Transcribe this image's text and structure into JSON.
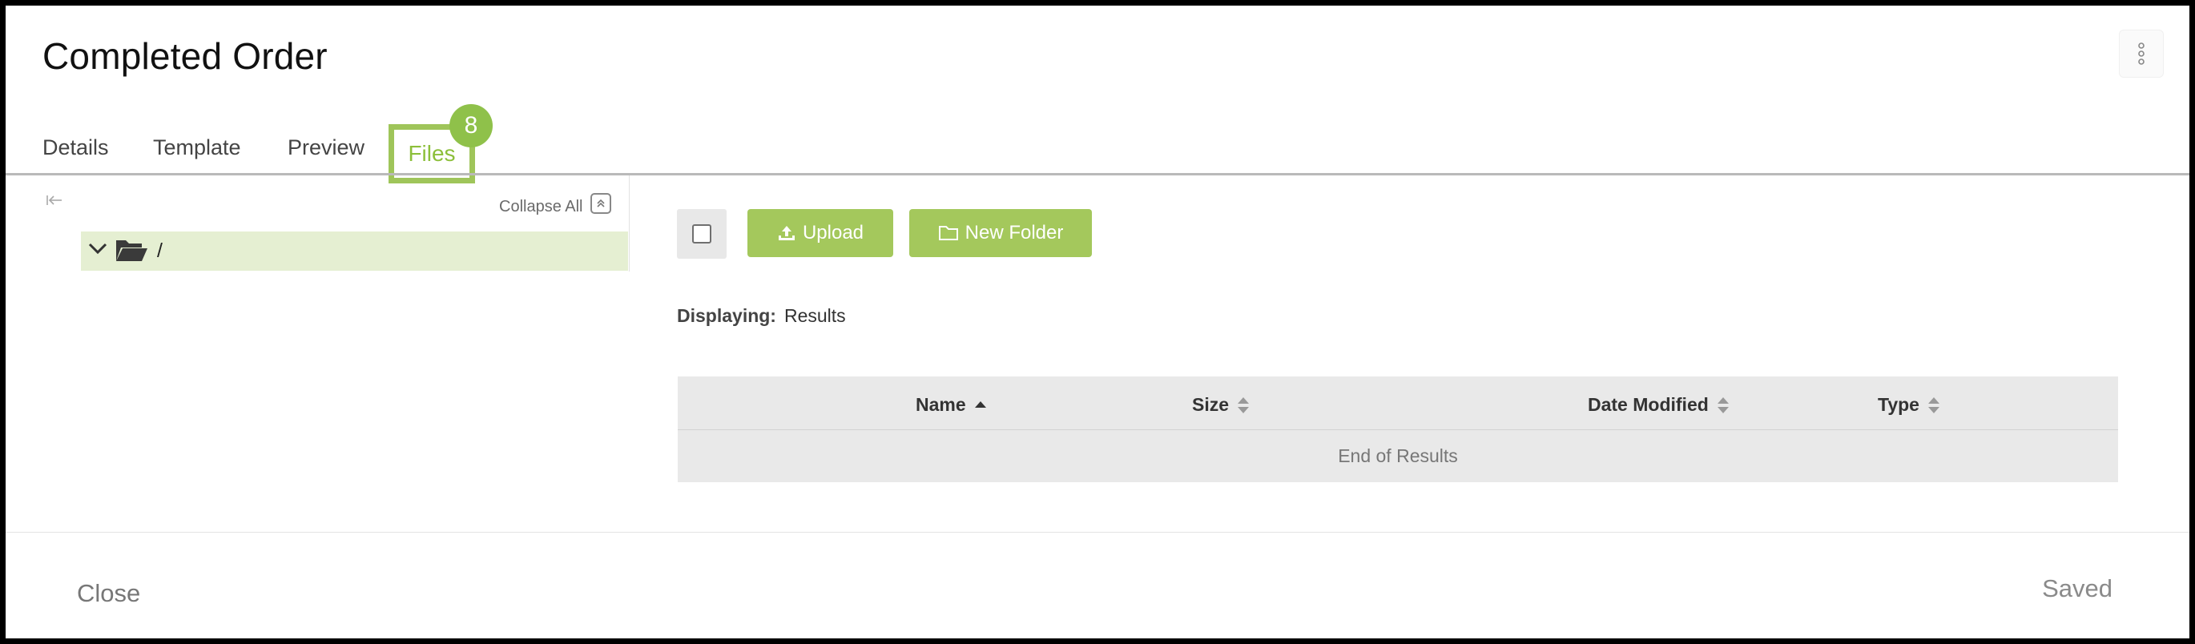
{
  "dialog": {
    "title": "Completed Order",
    "menu_icon": "kebab-vertical-icon"
  },
  "tabs": [
    {
      "label": "Details",
      "active": false
    },
    {
      "label": "Template",
      "active": false
    },
    {
      "label": "Preview",
      "active": false
    },
    {
      "label": "Files",
      "active": true,
      "badge": "8"
    }
  ],
  "sidebar": {
    "collapse_icon": "collapse-left-icon",
    "collapse_all_label": "Collapse All",
    "tree": [
      {
        "label": "/",
        "expanded": true,
        "selected": true,
        "icon": "folder-open-icon"
      }
    ]
  },
  "toolbar": {
    "upload_label": "Upload",
    "new_folder_label": "New Folder"
  },
  "displaying": {
    "label": "Displaying:",
    "value": "Results"
  },
  "table": {
    "columns": [
      {
        "label": "Name",
        "sort": "ascending"
      },
      {
        "label": "Size",
        "sort": "none"
      },
      {
        "label": "Date Modified",
        "sort": "none"
      },
      {
        "label": "Type",
        "sort": "none"
      }
    ],
    "end_message": "End of Results"
  },
  "footer": {
    "close_label": "Close",
    "status_label": "Saved"
  },
  "colors": {
    "accent": "#a4c85c",
    "accent_dark": "#8cbf3a",
    "tree_selected": "#e5efd2"
  }
}
